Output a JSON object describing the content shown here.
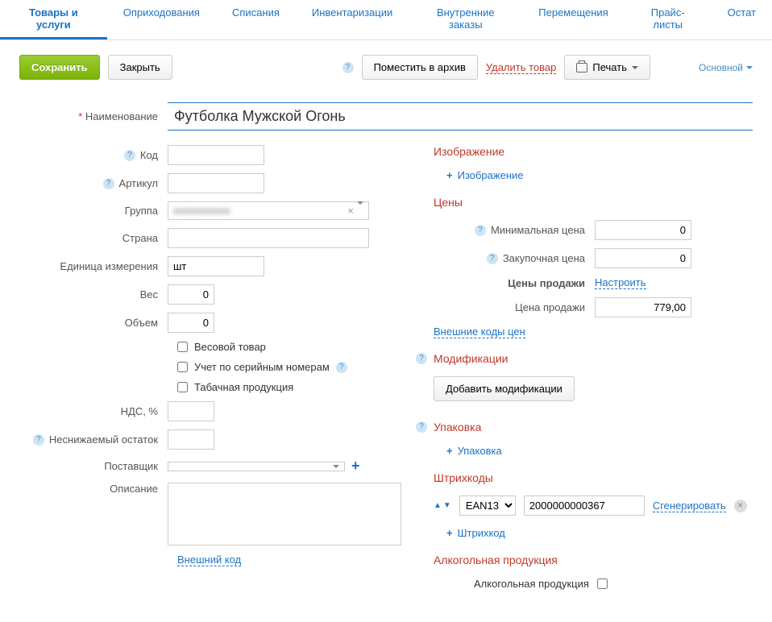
{
  "nav": [
    "Товары и услуги",
    "Оприходования",
    "Списания",
    "Инвентаризации",
    "Внутренние заказы",
    "Перемещения",
    "Прайс-листы",
    "Остат"
  ],
  "toolbar": {
    "save": "Сохранить",
    "close": "Закрыть",
    "archive": "Поместить в архив",
    "delete": "Удалить товар",
    "print": "Печать",
    "main": "Основной"
  },
  "labels": {
    "name": "Наименование",
    "code": "Код",
    "article": "Артикул",
    "group": "Группа",
    "country": "Страна",
    "unit": "Единица измерения",
    "weight": "Вес",
    "volume": "Объем",
    "weight_goods": "Весовой товар",
    "serial": "Учет по серийным номерам",
    "tobacco": "Табачная продукция",
    "vat": "НДС, %",
    "min_stock": "Неснижаемый остаток",
    "supplier": "Поставщик",
    "description": "Описание",
    "ext_code": "Внешний код"
  },
  "values": {
    "name": "Футболка Мужской Огонь",
    "unit": "шт",
    "weight": "0",
    "volume": "0",
    "group_hint": "■■■■■■■■■"
  },
  "right": {
    "image_h": "Изображение",
    "image_add": "Изображение",
    "prices_h": "Цены",
    "min_price": "Минимальная цена",
    "min_price_v": "0",
    "purchase_price": "Закупочная цена",
    "purchase_price_v": "0",
    "sale_prices": "Цены продажи",
    "configure": "Настроить",
    "sale_price": "Цена продажи",
    "sale_price_v": "779,00",
    "ext_codes": "Внешние коды цен",
    "mods_h": "Модификации",
    "add_mods": "Добавить модификации",
    "pack_h": "Упаковка",
    "pack_add": "Упаковка",
    "barcodes_h": "Штрихкоды",
    "barcode_type": "EAN13",
    "barcode_value": "2000000000367",
    "generate": "Сгенерировать",
    "barcode_add": "Штрихкод",
    "alcohol_h": "Алкогольная продукция",
    "alcohol_label": "Алкогольная продукция"
  }
}
